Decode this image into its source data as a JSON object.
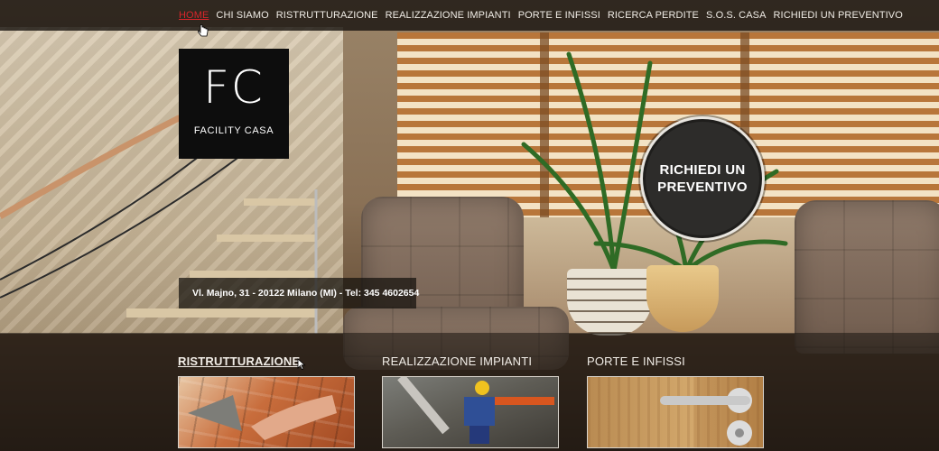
{
  "nav": {
    "items": [
      {
        "label": "HOME",
        "active": true
      },
      {
        "label": "CHI SIAMO"
      },
      {
        "label": "RISTRUTTURAZIONE"
      },
      {
        "label": "REALIZZAZIONE IMPIANTI"
      },
      {
        "label": "PORTE E INFISSI"
      },
      {
        "label": "RICERCA PERDITE"
      },
      {
        "label": "S.O.S. CASA"
      },
      {
        "label": "RICHIEDI UN PREVENTIVO"
      }
    ],
    "active_color": "#d8262b"
  },
  "logo": {
    "mark": "FC",
    "name": "FACILITY CASA"
  },
  "address": {
    "text": "Vl. Majno, 31 - 20122 Milano (MI) - Tel: 345 4602654"
  },
  "cta": {
    "label": "RICHIEDI UN PREVENTIVO"
  },
  "services": [
    {
      "title": "RISTRUTTURAZIONE",
      "image": "bricklaying-photo"
    },
    {
      "title": "REALIZZAZIONE IMPIANTI",
      "image": "plumbing-pipes-photo"
    },
    {
      "title": "PORTE E INFISSI",
      "image": "door-handle-photo"
    }
  ],
  "background": {
    "image": "living-room-interior-photo"
  }
}
